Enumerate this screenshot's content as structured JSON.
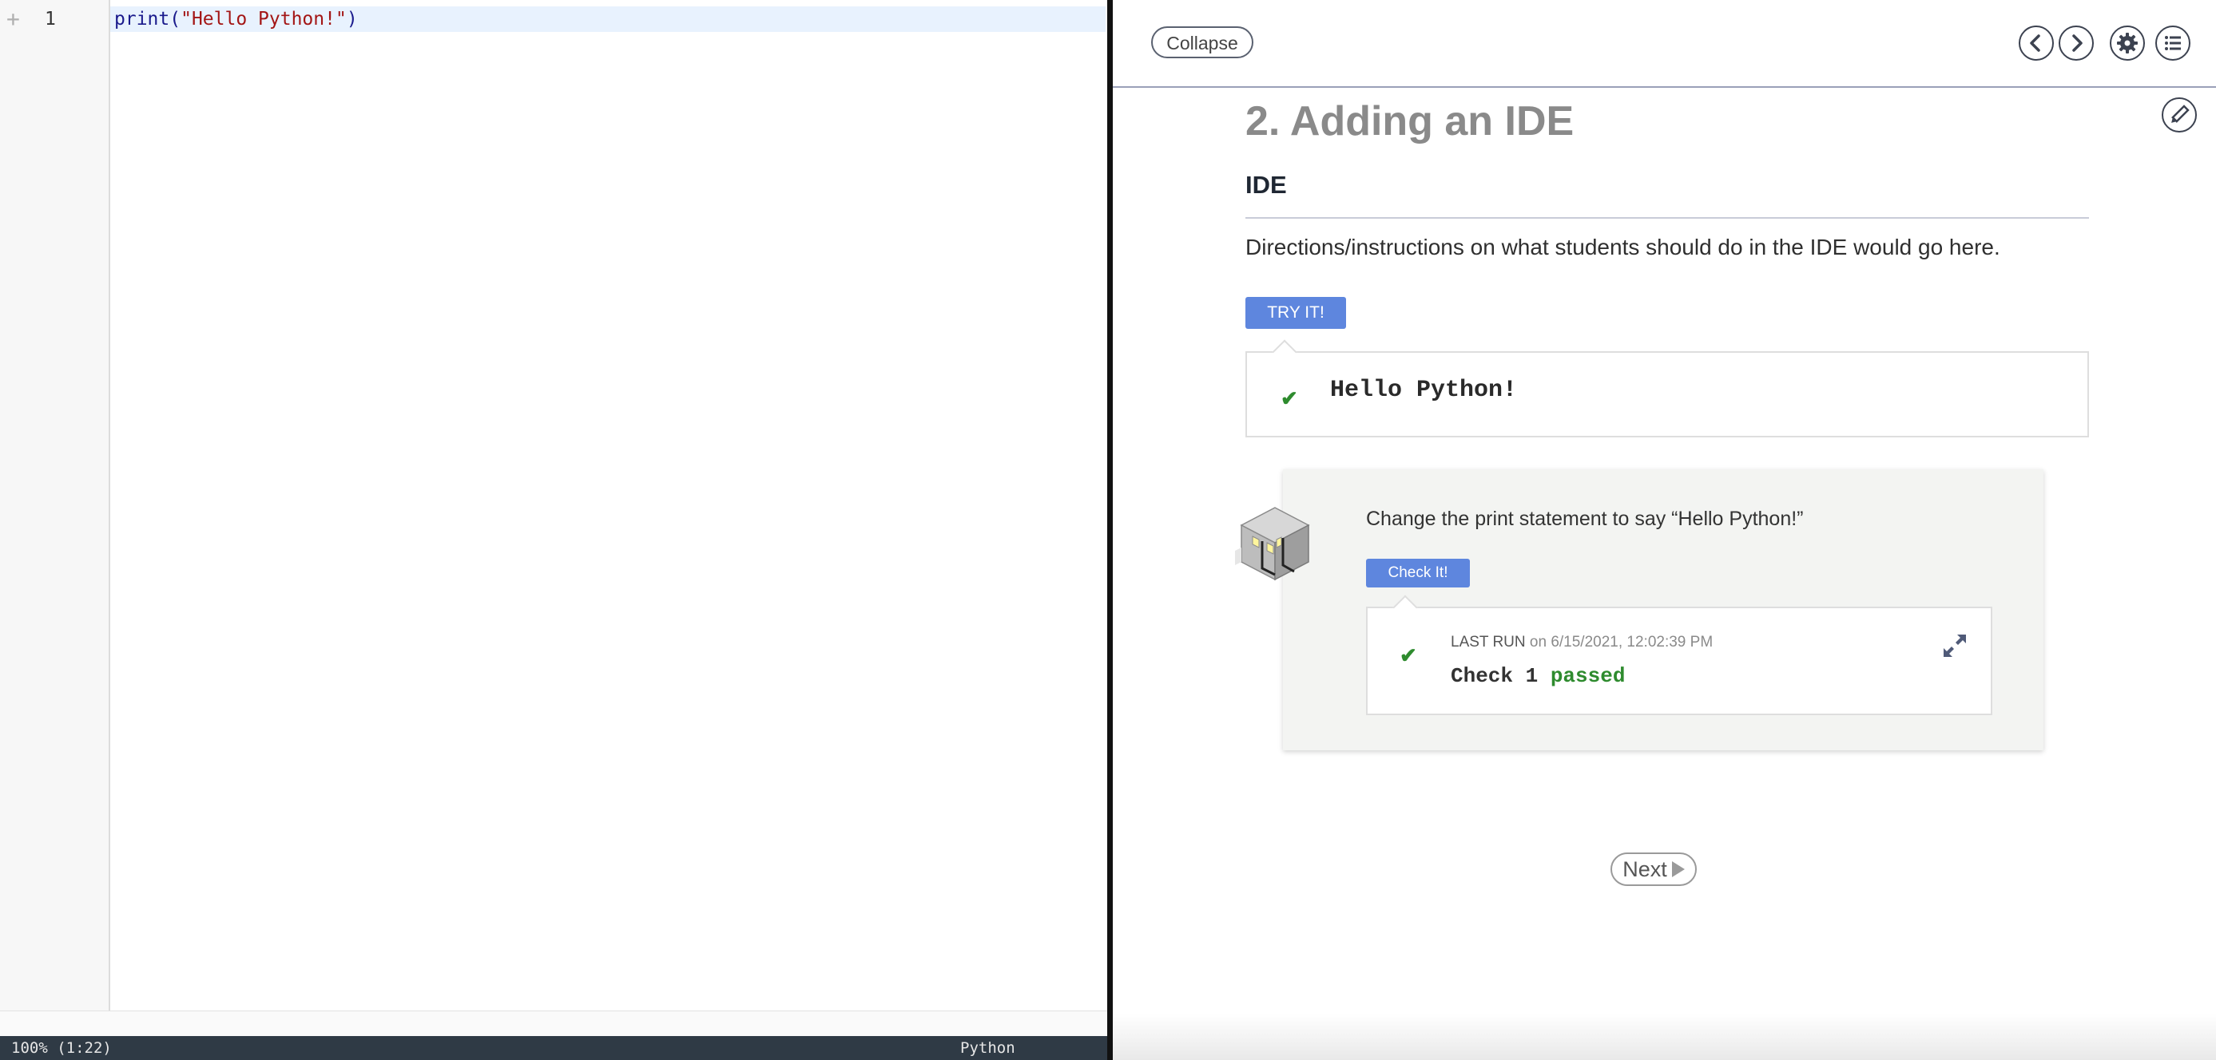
{
  "editor": {
    "fold_marker": "+",
    "line_number": "1",
    "code_tokens": {
      "fn": "print",
      "open": "(",
      "str": "\"Hello Python!\"",
      "close": ")"
    },
    "status": {
      "zoom_position": "100%  (1:22)",
      "language": "Python"
    }
  },
  "guide": {
    "collapse_label": "Collapse",
    "page_title": "2. Adding an IDE",
    "section_title": "IDE",
    "directions": "Directions/instructions on what students should do in the IDE would go here.",
    "try_button": "TRY IT!",
    "output": "Hello Python!",
    "challenge": {
      "prompt": "Change the print statement to say “Hello Python!”",
      "check_button": "Check It!",
      "last_run_label": "LAST RUN",
      "last_run_time": "on 6/15/2021, 12:02:39 PM",
      "result_prefix": "Check 1 ",
      "result_status": "passed"
    },
    "next_label": "Next",
    "icons": {
      "prev": "chevron-left-icon",
      "next": "chevron-right-icon",
      "settings": "gear-icon",
      "toc": "list-icon",
      "edit": "pencil-icon",
      "expand": "expand-icon"
    }
  },
  "colors": {
    "accent_button": "#5e86de",
    "success": "#2e8b2e",
    "statusbar": "#2f3a45"
  }
}
